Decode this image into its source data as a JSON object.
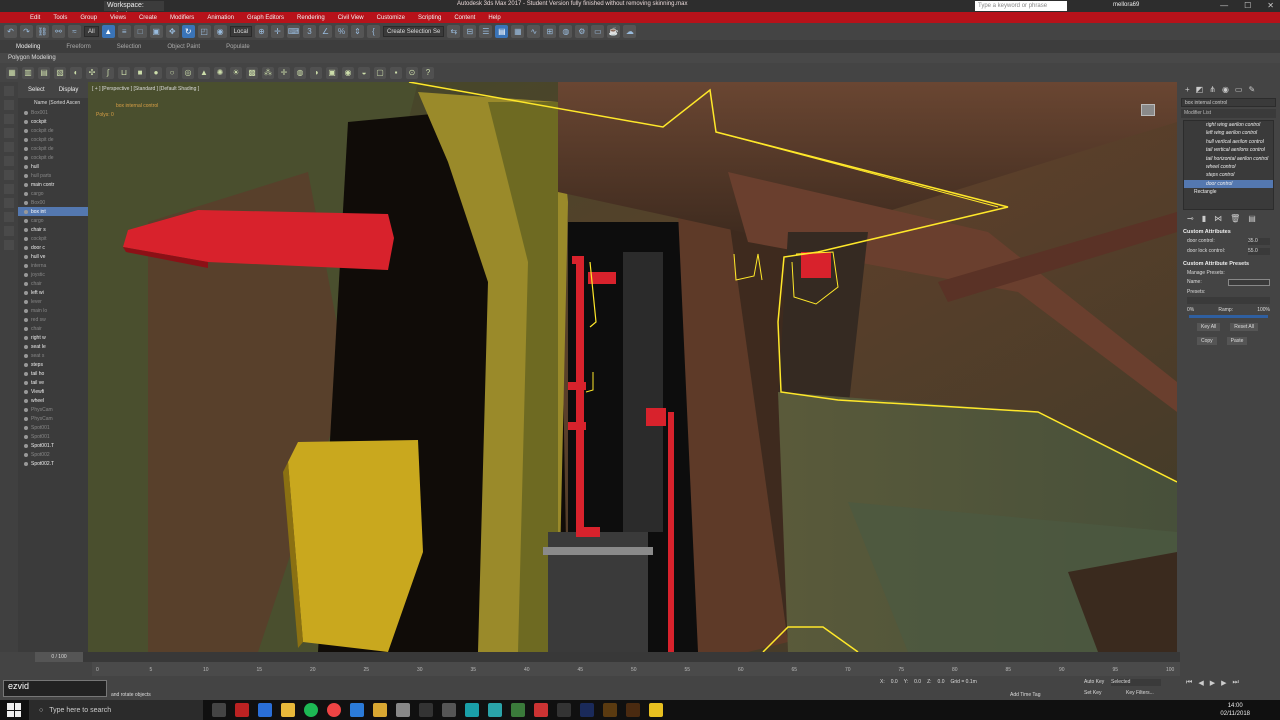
{
  "titlebar": {
    "workspace": "Workspace: Default",
    "title": "Autodesk 3ds Max 2017 - Student Version   fully finished without removing skinning.max",
    "search_placeholder": "Type a keyword or phrase",
    "user": "mellora69",
    "min": "—",
    "max": "☐",
    "close": "✕"
  },
  "menu": [
    "Edit",
    "Tools",
    "Group",
    "Views",
    "Create",
    "Modifiers",
    "Animation",
    "Graph Editors",
    "Rendering",
    "Civil View",
    "Customize",
    "Scripting",
    "Content",
    "Help"
  ],
  "toolbar": {
    "filter": "All",
    "refcoord": "Local",
    "selection_set": "Create Selection Se"
  },
  "ribbon_tabs": [
    "Modeling",
    "Freeform",
    "Selection",
    "Object Paint",
    "Populate"
  ],
  "ribbon_label": "Polygon Modeling",
  "scene_explorer": {
    "tab_select": "Select",
    "tab_display": "Display",
    "header": "Name (Sorted Ascen",
    "rows": [
      {
        "label": "Box001",
        "style": "dim"
      },
      {
        "label": "cockpit",
        "style": "wh"
      },
      {
        "label": "cockpit de",
        "style": "dim"
      },
      {
        "label": "cockpit de",
        "style": "dim"
      },
      {
        "label": "cockpit de",
        "style": "dim"
      },
      {
        "label": "cockpit de",
        "style": "dim"
      },
      {
        "label": "hull",
        "style": "wh"
      },
      {
        "label": "hull parts",
        "style": "dim"
      },
      {
        "label": "main contr",
        "style": "wh"
      },
      {
        "label": "cargo",
        "style": "dim"
      },
      {
        "label": "Box00",
        "style": "dim"
      },
      {
        "label": "box int",
        "style": "hi"
      },
      {
        "label": "cargo",
        "style": "dim"
      },
      {
        "label": "chair s",
        "style": "wh"
      },
      {
        "label": "cockpit",
        "style": "dim"
      },
      {
        "label": "door c",
        "style": "wh"
      },
      {
        "label": "hull ve",
        "style": "wh"
      },
      {
        "label": "interna",
        "style": "dim"
      },
      {
        "label": "joystic",
        "style": "dim"
      },
      {
        "label": "chair",
        "style": "dim"
      },
      {
        "label": "left wi",
        "style": "wh"
      },
      {
        "label": "lever",
        "style": "dim"
      },
      {
        "label": "main lo",
        "style": "dim"
      },
      {
        "label": "red sw",
        "style": "dim"
      },
      {
        "label": "chair",
        "style": "dim"
      },
      {
        "label": "right w",
        "style": "wh"
      },
      {
        "label": "seat le",
        "style": "wh"
      },
      {
        "label": "seat s",
        "style": "dim"
      },
      {
        "label": "steps",
        "style": "wh"
      },
      {
        "label": "tail ho",
        "style": "wh"
      },
      {
        "label": "tail ve",
        "style": "wh"
      },
      {
        "label": "Viewfi",
        "style": "wh"
      },
      {
        "label": "wheel",
        "style": "wh"
      },
      {
        "label": "PhysCam",
        "style": "dim"
      },
      {
        "label": "PhysCam",
        "style": "dim"
      },
      {
        "label": "Spot001",
        "style": "dim"
      },
      {
        "label": "Spot001",
        "style": "dim"
      },
      {
        "label": "Spot001.T",
        "style": "wh"
      },
      {
        "label": "Spot002",
        "style": "dim"
      },
      {
        "label": "Spot002.T",
        "style": "wh"
      }
    ]
  },
  "viewport": {
    "label": "[ + ] [Perspective ] [Standard ] [Default Shading ]",
    "info_name": "box internal control",
    "info_polys_label": "Polys:",
    "info_polys_value": "0"
  },
  "command_panel": {
    "object_name": "box internal control",
    "modifier_list": "Modifier List",
    "stack": [
      {
        "label": "right wing aerilon control",
        "hi": false
      },
      {
        "label": "left wing aerilon control",
        "hi": false
      },
      {
        "label": "hull vertical aerilon control",
        "hi": false
      },
      {
        "label": "tail vertical aerilons control",
        "hi": false
      },
      {
        "label": "tail horizontal aerilon control",
        "hi": false
      },
      {
        "label": "wheel control",
        "hi": false
      },
      {
        "label": "steps control",
        "hi": false
      },
      {
        "label": "door control",
        "hi": true
      }
    ],
    "base": "Rectangle",
    "custom_attributes": "Custom Attributes",
    "door_control_label": "door control:",
    "door_control_value": "35.0",
    "door_lock_label": "door lock control:",
    "door_lock_value": "55.0",
    "presets_header": "Custom Attribute Presets",
    "manage_presets": "Manage Presets:",
    "name_label": "Name:",
    "presets_label": "Presets:",
    "ramp_min": "0%",
    "ramp_label": "Ramp:",
    "ramp_max": "100%",
    "btn_key_all": "Key All",
    "btn_reset_all": "Reset All",
    "btn_copy": "Copy",
    "btn_paste": "Paste"
  },
  "timeline": {
    "slider_text": "0 / 100",
    "ticks": [
      "0",
      "5",
      "10",
      "15",
      "20",
      "25",
      "30",
      "35",
      "40",
      "45",
      "50",
      "55",
      "60",
      "65",
      "70",
      "75",
      "80",
      "85",
      "90",
      "95",
      "100"
    ]
  },
  "status": {
    "ezvid": "ezvid",
    "message": "and rotate objects",
    "x_label": "X:",
    "x_value": "0.0",
    "y_label": "Y:",
    "y_value": "0.0",
    "z_label": "Z:",
    "z_value": "0.0",
    "grid": "Grid = 0.1m",
    "add_time_tag": "Add Time Tag",
    "auto_key": "Auto Key",
    "set_key": "Set Key",
    "selected": "Selected",
    "key_filters": "Key Filters..."
  },
  "taskbar": {
    "search": "Type here to search",
    "time": "14:00",
    "date": "02/11/2018"
  },
  "colors": {
    "accent": "#3a74b8",
    "title_red": "#b7121a",
    "selection_yellow": "#ffe82a",
    "gizmo_red": "#d8222c"
  }
}
